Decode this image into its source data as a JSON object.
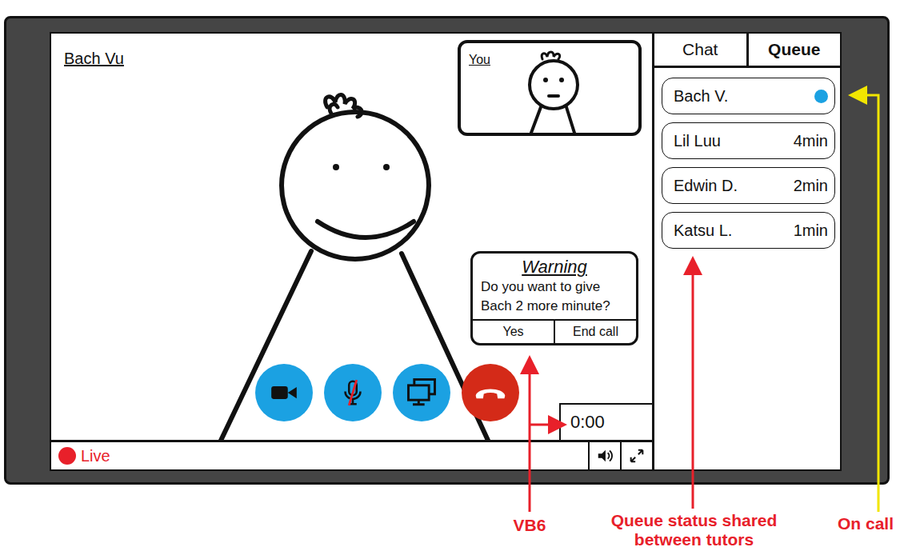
{
  "window": {
    "caller": "Bach Vu"
  },
  "self_view": {
    "label": "You"
  },
  "warning": {
    "title": "Warning",
    "message": "Do you want to give Bach 2 more minute?",
    "buttons": [
      "Yes",
      "End call"
    ]
  },
  "controls": [
    {
      "kind": "camera",
      "off": false
    },
    {
      "kind": "microphone",
      "off": true
    },
    {
      "kind": "share",
      "off": false
    },
    {
      "kind": "hangup",
      "off": false
    }
  ],
  "timer": "0:00",
  "status_bar": {
    "live": "Live"
  },
  "tabs": [
    {
      "label": "Chat",
      "selected": false
    },
    {
      "label": "Queue",
      "selected": true
    }
  ],
  "queue": [
    {
      "name": "Bach V.",
      "on_call": true
    },
    {
      "name": "Lil Luu",
      "on_call": false,
      "wait": "4min"
    },
    {
      "name": "Edwin D.",
      "on_call": false,
      "wait": "2min"
    },
    {
      "name": "Katsu L.",
      "on_call": false,
      "wait": "1min"
    }
  ],
  "annotations": [
    {
      "label": "VB6",
      "color": "#e8202a"
    },
    {
      "label": "Queue status shared between tutors",
      "color": "#e8202a"
    },
    {
      "label": "On call",
      "color": "#f2e600"
    }
  ]
}
